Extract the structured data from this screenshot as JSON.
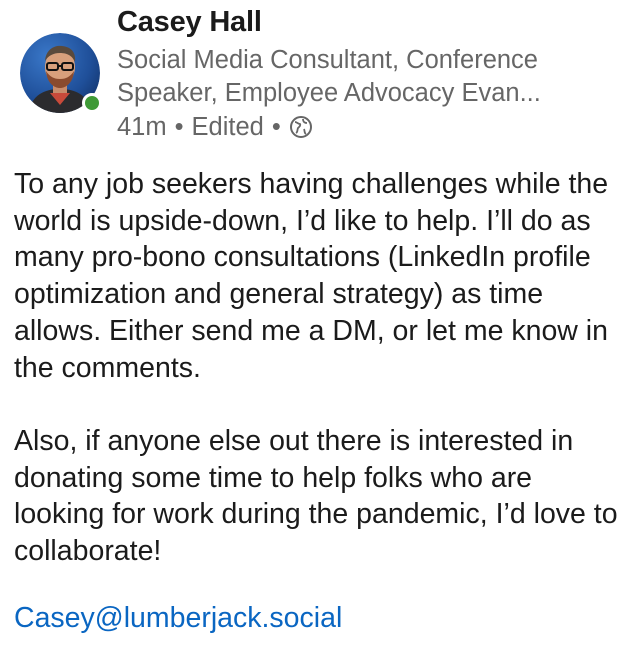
{
  "post": {
    "author": {
      "name": "Casey Hall",
      "headline": "Social Media Consultant, Conference Speaker, Employee Advocacy Evan...",
      "online_status_color": "#3f9a36"
    },
    "meta": {
      "time": "41m",
      "edited": "Edited",
      "separator": "•",
      "visibility_icon": "globe-icon"
    },
    "body": {
      "paragraphs": [
        "To any job seekers having challenges while the world is upside-down, I’d like to help.  I’ll do as many pro-bono consultations (LinkedIn profile optimization and general strategy) as time allows.  Either send me a DM, or let me know in the comments.",
        "Also, if anyone else out there is interested in donating some time to help folks who are looking for work during the pandemic, I’d love to collaborate!"
      ]
    },
    "email_link": "Casey@lumberjack.social",
    "colors": {
      "link": "#0a66c2",
      "secondary_text": "#666666",
      "primary_text": "#1b1b1b"
    }
  }
}
